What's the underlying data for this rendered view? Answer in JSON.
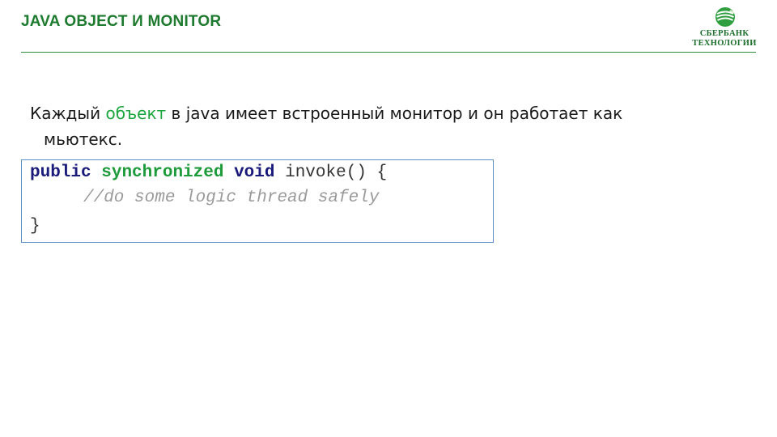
{
  "header": {
    "title": "JAVA OBJECT И MONITOR",
    "logo": {
      "line1": "СБЕРБАНК",
      "line2": "ТЕХНОЛОГИИ",
      "icon": "sberbank-logo-icon",
      "color": "#1b6e2b"
    }
  },
  "content": {
    "paragraph": {
      "before": "Каждый ",
      "highlight": "объект",
      "after": " в java имеет встроенный монитор и  он работает как",
      "continuation": "мьютекс."
    },
    "code": {
      "line1": {
        "kw1": "public",
        "kw2": "synchronized",
        "kw3": "void",
        "rest": " invoke() {"
      },
      "line2": "//do some logic thread safely",
      "line3": "}"
    }
  },
  "colors": {
    "title": "#1d7a2e",
    "highlight": "#1aa63c",
    "keyword_navy": "#1a1a7a",
    "keyword_green": "#1d9a3a",
    "comment": "#9a9a9a",
    "code_border": "#5b8fc9"
  }
}
